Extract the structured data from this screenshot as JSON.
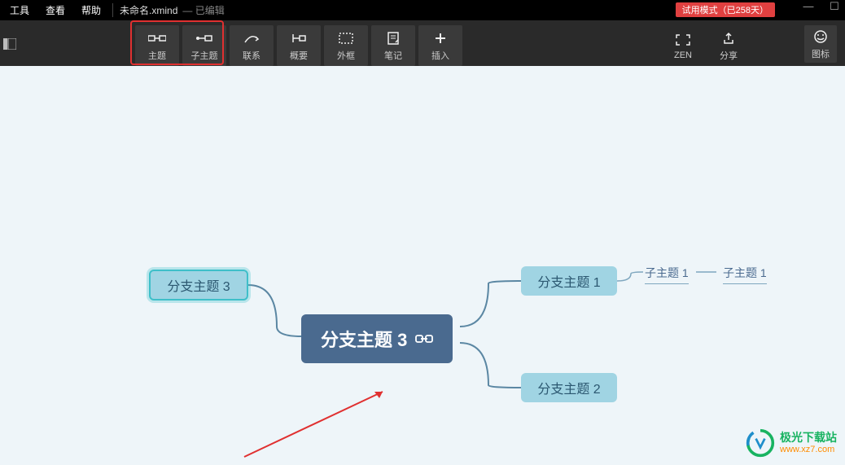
{
  "menubar": {
    "items": [
      "工具",
      "查看",
      "帮助"
    ],
    "filename": "未命名.xmind",
    "edited": "— 已编辑",
    "trial": "试用模式（已258天）"
  },
  "toolbar": {
    "topic": "主题",
    "subtopic": "子主题",
    "relation": "联系",
    "summary": "概要",
    "boundary": "外框",
    "note": "笔记",
    "insert": "插入",
    "zen": "ZEN",
    "share": "分享",
    "icons": "图标"
  },
  "nodes": {
    "central": "分支主题 3",
    "branch1": "分支主题 1",
    "branch2": "分支主题 2",
    "branch3": "分支主题 3",
    "sub1": "子主题 1",
    "sub2": "子主题 1"
  },
  "watermark": {
    "title": "极光下载站",
    "url": "www.xz7.com"
  }
}
